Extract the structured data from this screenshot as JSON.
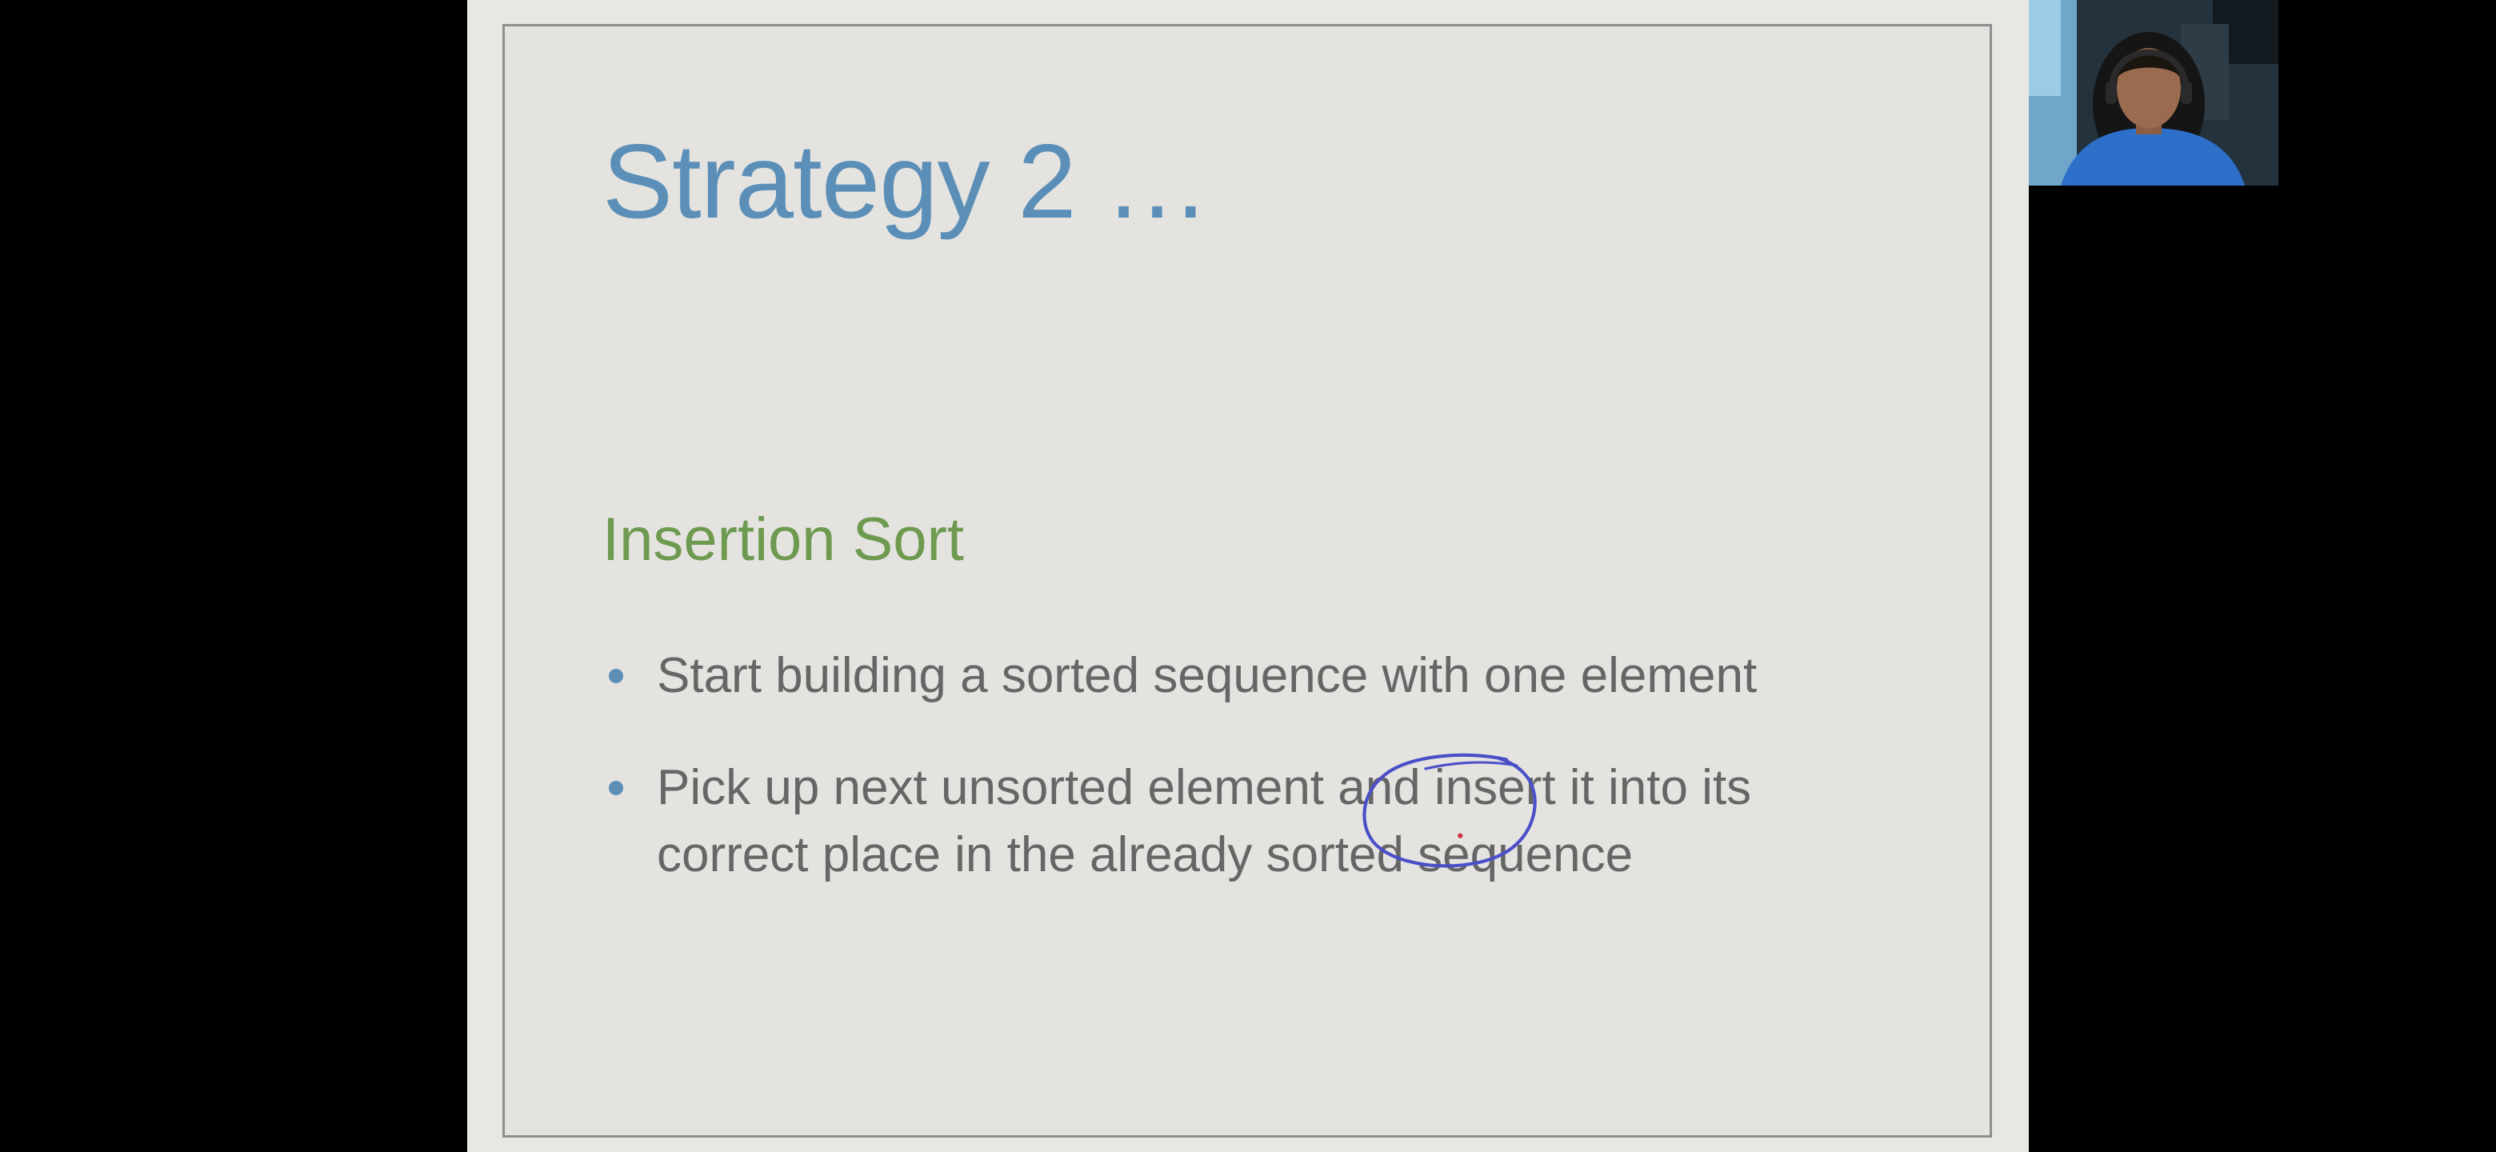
{
  "slide": {
    "title": "Strategy 2 …",
    "heading": "Insertion Sort",
    "bullets": [
      {
        "line1": "Start building a sorted sequence with one element"
      },
      {
        "line1": "Pick up next unsorted element and insert it into its",
        "line2": "correct place in the already sorted sequence"
      }
    ]
  },
  "annotation": {
    "icon": "ink-circle-annotation",
    "color": "#4a4fc8",
    "circled_word": "insert"
  },
  "webcam": {
    "icon": "presenter-video-feed"
  },
  "colors": {
    "title": "#5b8fb8",
    "heading": "#6e9a50",
    "body_text": "#666666",
    "bullet": "#5b8fb8",
    "slide_background": "#e4e3e0",
    "screen_background": "#000000"
  }
}
